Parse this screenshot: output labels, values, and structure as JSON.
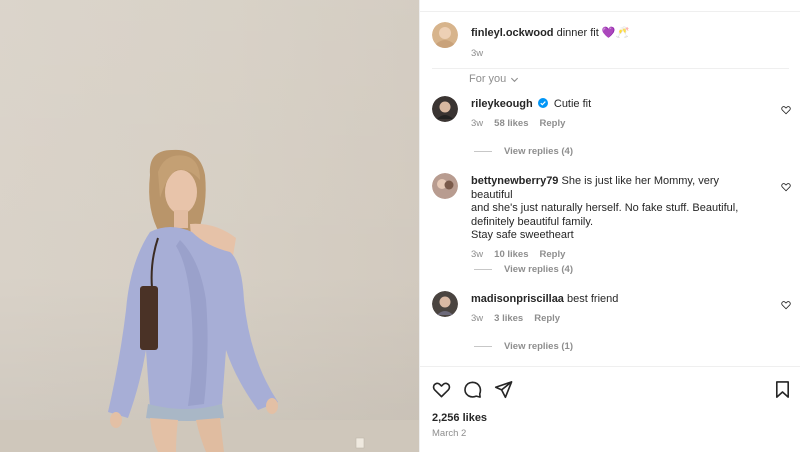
{
  "post": {
    "author": "finleyl.ockwood",
    "caption": "dinner fit 💜🥂",
    "age": "3w",
    "likes": "2,256 likes",
    "date": "March 2"
  },
  "sort": {
    "label": "For you"
  },
  "comments": [
    {
      "user": "rileykeough",
      "verified": true,
      "lines": [
        "Cutie fit"
      ],
      "age": "3w",
      "likes": "58 likes",
      "reply": "Reply",
      "view_replies": "View replies (4)"
    },
    {
      "user": "bettynewberry79",
      "verified": false,
      "lines": [
        "She is just like her Mommy, very beautiful",
        "and she's just naturally herself. No fake stuff. Beautiful,",
        "definitely beautiful family.",
        "Stay safe sweetheart"
      ],
      "age": "3w",
      "likes": "10 likes",
      "reply": "Reply",
      "view_replies": "View replies (4)"
    },
    {
      "user": "madisonpriscillaa",
      "verified": false,
      "lines": [
        "best friend"
      ],
      "age": "3w",
      "likes": "3 likes",
      "reply": "Reply",
      "view_replies": "View replies (1)"
    }
  ],
  "icons": {
    "like": "heart-icon",
    "comment": "comment-icon",
    "share": "share-icon",
    "save": "bookmark-icon",
    "verified": "verified-badge-icon",
    "comment_like": "heart-outline-icon"
  },
  "colors": {
    "text": "#262626",
    "muted": "#8e8e8e",
    "verified": "#0095f6",
    "divider": "#efefef"
  }
}
